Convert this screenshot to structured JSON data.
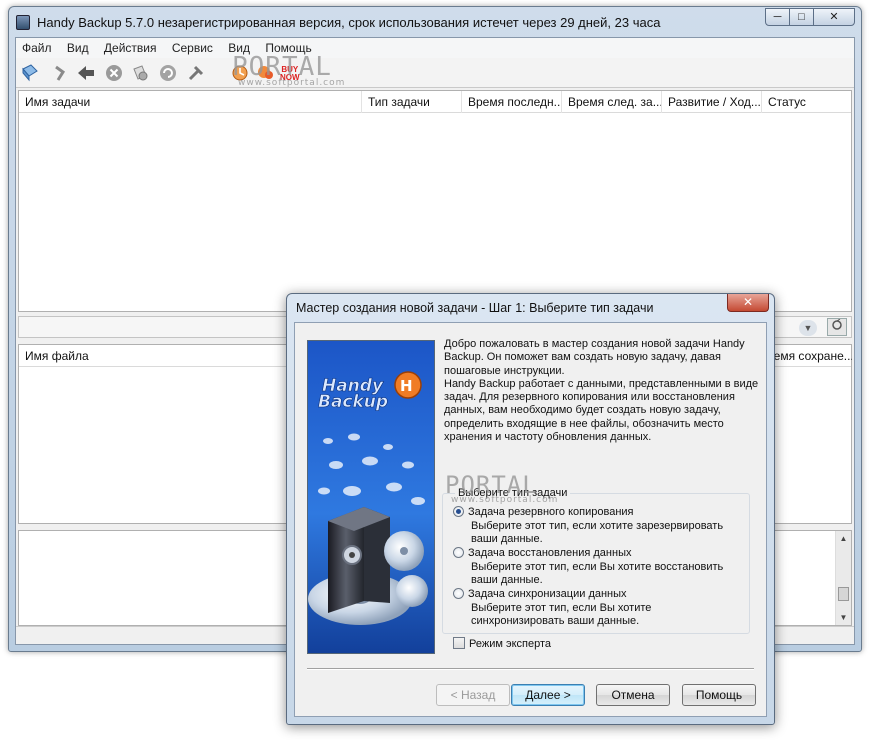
{
  "window": {
    "title": "Handy Backup 5.7.0 незарегистрированная версия, срок использования истечет через  29 дней, 23 часа",
    "caption_minimize": "─",
    "caption_maximize": "□",
    "caption_close": "✕"
  },
  "menu": {
    "items": [
      "Файл",
      "Вид",
      "Действия",
      "Сервис",
      "Вид",
      "Помощь"
    ]
  },
  "toolbar": {
    "buy_label_1": "BUY",
    "buy_label_2": "NOW",
    "icons": [
      "new-task-icon",
      "edit-icon",
      "back-arrow-icon",
      "stop-icon",
      "search-icon",
      "refresh-icon",
      "tools-icon",
      "schedule-icon",
      "buy-now-icon"
    ]
  },
  "watermark": {
    "big": "PORTAL",
    "small": "www.softportal.com"
  },
  "task_list": {
    "columns": [
      "Имя задачи",
      "Тип задачи",
      "Время последн...",
      "Время след. за...",
      "Развитие / Ход...",
      "Статус"
    ]
  },
  "file_list": {
    "columns": [
      "Имя файла",
      "Время сохране..."
    ]
  },
  "wizard": {
    "title": "Мастер создания новой задачи - Шаг 1: Выберите тип задачи",
    "close": "✕",
    "logo_line1": "Handy",
    "logo_line2": "Backup",
    "intro_1": "Добро пожаловать в мастер создания новой задачи Handy Backup. Он поможет вам создать новую задачу, давая пошаговые инструкции.",
    "intro_2": "Handy Backup работает с данными, представленными в виде задач. Для резервного копирования или восстановления данных, вам необходимо будет создать новую задачу, определить входящие в нее файлы, обозначить место хранения и частоту обновления данных.",
    "group_caption": "Выберите тип задачи",
    "options": [
      {
        "label": "Задача резервного копирования",
        "desc_1": "Выберите этот тип, если хотите зарезервировать",
        "desc_2": "ваши данные.",
        "checked": true
      },
      {
        "label": "Задача восстановления данных",
        "desc_1": "Выберите этот тип, если Вы хотите восстановить",
        "desc_2": "ваши данные.",
        "checked": false
      },
      {
        "label": "Задача синхронизации данных",
        "desc_1": "Выберите этот тип, если Вы хотите",
        "desc_2": "синхронизировать ваши данные.",
        "checked": false
      }
    ],
    "expert_mode": "Режим эксперта",
    "buttons": {
      "back": "< Назад",
      "next": "Далее >",
      "cancel": "Отмена",
      "help": "Помощь"
    }
  }
}
